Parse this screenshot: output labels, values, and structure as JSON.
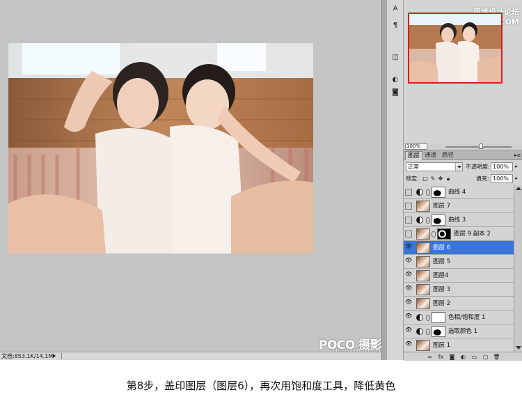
{
  "colors": {
    "canvas_bg": "#c4c4c4",
    "panel_bg": "#d4d4d4",
    "selected_row": "#3875d7",
    "navigator_frame": "#d62020"
  },
  "status_bar": {
    "doc_size": "文档:853.1K/14.1M"
  },
  "navigator": {
    "watermark": "思缘设计论坛 WWW.MISSYUAN.COM",
    "zoom": "100%"
  },
  "tools": [
    {
      "name": "A-icon",
      "glyph": "A"
    },
    {
      "name": "paragraph-icon",
      "glyph": "¶"
    },
    {
      "name": "layers-comp-icon",
      "glyph": "◫"
    },
    {
      "name": "adjust-icon",
      "glyph": "◐"
    },
    {
      "name": "mask-icon",
      "glyph": "◙"
    }
  ],
  "layers_panel": {
    "tabs": [
      "图层",
      "通道",
      "路径"
    ],
    "blend_mode": "正常",
    "opacity_label": "不透明度:",
    "opacity_value": "100%",
    "lock_label": "锁定:",
    "fill_label": "填充:",
    "fill_value": "100%",
    "layers": [
      {
        "name": "曲线 4",
        "visible": false,
        "type": "adjustment",
        "selected": false
      },
      {
        "name": "图层 7",
        "visible": false,
        "type": "pixel",
        "selected": false
      },
      {
        "name": "曲线 3",
        "visible": false,
        "type": "adjustment",
        "selected": false
      },
      {
        "name": "图层 9 副本 2",
        "visible": false,
        "type": "masked",
        "selected": false
      },
      {
        "name": "图层 6",
        "visible": true,
        "type": "pixel",
        "selected": true
      },
      {
        "name": "图层 5",
        "visible": true,
        "type": "pixel",
        "selected": false
      },
      {
        "name": "图层4",
        "visible": true,
        "type": "pixel",
        "selected": false
      },
      {
        "name": "图层 3",
        "visible": true,
        "type": "pixel",
        "selected": false
      },
      {
        "name": "图层 2",
        "visible": true,
        "type": "pixel",
        "selected": false
      },
      {
        "name": "色相/饱和度 1",
        "visible": true,
        "type": "adjustment-white",
        "selected": false
      },
      {
        "name": "选取颜色 1",
        "visible": true,
        "type": "adjustment",
        "selected": false
      },
      {
        "name": "图层 1",
        "visible": true,
        "type": "pixel",
        "selected": false
      }
    ]
  },
  "watermark": {
    "brand": "POCO 摄影专题",
    "url": "http://photo.poco.cn/"
  },
  "caption": "第8步，盖印图层（图层6），再次用饱和度工具，降低黄色"
}
